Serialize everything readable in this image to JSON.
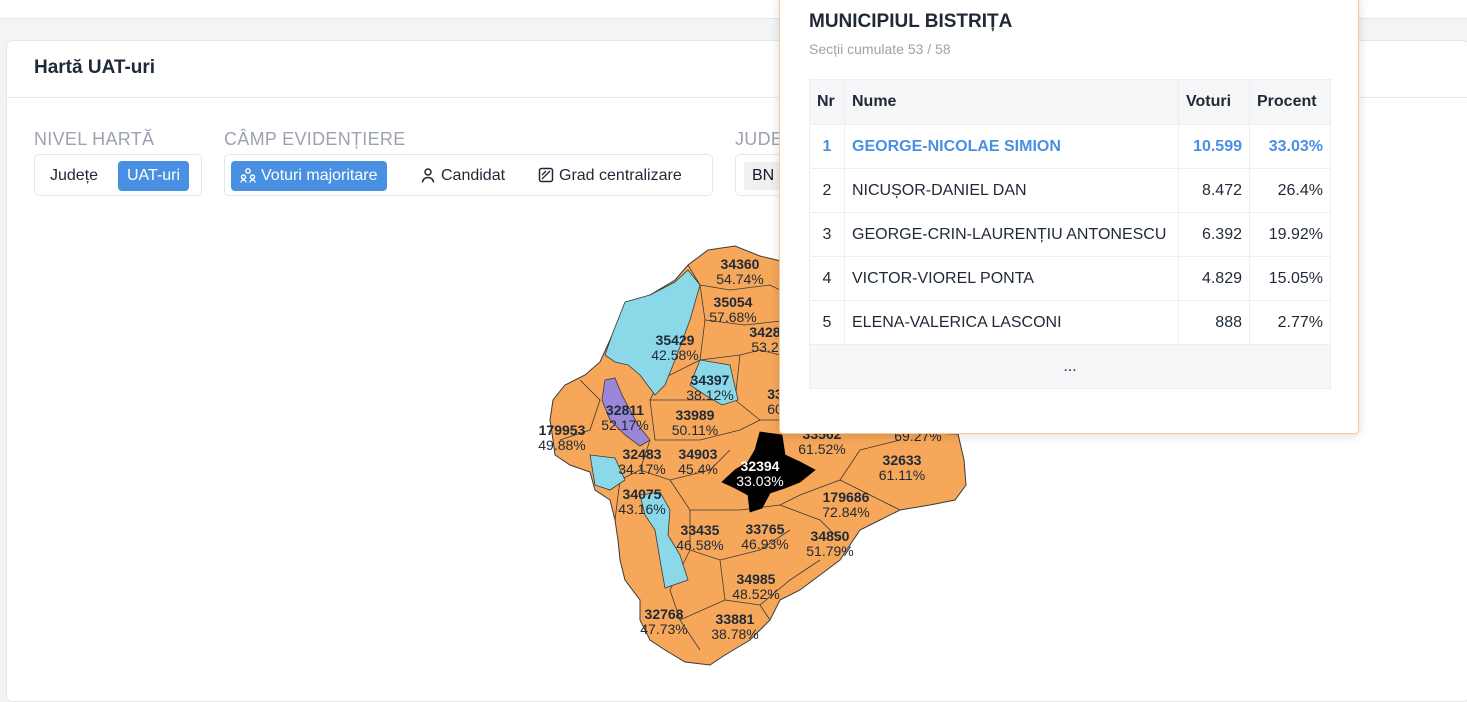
{
  "page": {
    "title": "Hartă UAT-uri"
  },
  "controls": {
    "nivel_label": "NIVEL HARTĂ",
    "nivel_options": [
      {
        "label": "Județe",
        "active": false
      },
      {
        "label": "UAT-uri",
        "active": true
      }
    ],
    "camp_label": "CÂMP EVIDENȚIERE",
    "camp_options": [
      {
        "label": "Voturi majoritare",
        "icon": "people-group-icon",
        "active": true
      },
      {
        "label": "Candidat",
        "icon": "person-icon",
        "active": false
      },
      {
        "label": "Grad centralizare",
        "icon": "gauge-square-icon",
        "active": false
      }
    ],
    "judet_label": "JUDE",
    "judet_value": "BN"
  },
  "colors": {
    "accent": "#4a90e2",
    "orange": "#f6a75a",
    "cyan": "#8ad8e8",
    "purple": "#9b86d8",
    "selected": "#000000"
  },
  "map": {
    "labels": [
      {
        "code": "34360",
        "pct": "54.74%"
      },
      {
        "code": "35054",
        "pct": "57.68%"
      },
      {
        "code": "3428",
        "pct": "53.2"
      },
      {
        "code": "35429",
        "pct": "42.58%"
      },
      {
        "code": "34397",
        "pct": "38.12%"
      },
      {
        "code": "33",
        "pct": "60"
      },
      {
        "code": "32811",
        "pct": "52.17%"
      },
      {
        "code": "33989",
        "pct": "50.11%"
      },
      {
        "code": "179953",
        "pct": "49.88%"
      },
      {
        "code": "33562",
        "pct": "61.52%"
      },
      {
        "code": "",
        "pct": "69.27%"
      },
      {
        "code": "32483",
        "pct": "34.17%"
      },
      {
        "code": "34903",
        "pct": "45.4%"
      },
      {
        "code": "32394",
        "pct": "33.03%"
      },
      {
        "code": "32633",
        "pct": "61.11%"
      },
      {
        "code": "34075",
        "pct": "43.16%"
      },
      {
        "code": "179686",
        "pct": "72.84%"
      },
      {
        "code": "33435",
        "pct": "46.58%"
      },
      {
        "code": "33765",
        "pct": "46.93%"
      },
      {
        "code": "34850",
        "pct": "51.79%"
      },
      {
        "code": "34985",
        "pct": "48.52%"
      },
      {
        "code": "32768",
        "pct": "47.73%"
      },
      {
        "code": "33881",
        "pct": "38.78%"
      }
    ]
  },
  "popup": {
    "title": "MUNICIPIUL BISTRIȚA",
    "subtitle": "Secții cumulate 53 / 58",
    "headers": [
      "Nr",
      "Nume",
      "Voturi",
      "Procent"
    ],
    "rows": [
      {
        "nr": "1",
        "name": "GEORGE-NICOLAE SIMION",
        "votes": "10.599",
        "pct": "33.03%"
      },
      {
        "nr": "2",
        "name": "NICUȘOR-DANIEL DAN",
        "votes": "8.472",
        "pct": "26.4%"
      },
      {
        "nr": "3",
        "name": "GEORGE-CRIN-LAURENȚIU ANTONESCU",
        "votes": "6.392",
        "pct": "19.92%"
      },
      {
        "nr": "4",
        "name": "VICTOR-VIOREL PONTA",
        "votes": "4.829",
        "pct": "15.05%"
      },
      {
        "nr": "5",
        "name": "ELENA-VALERICA LASCONI",
        "votes": "888",
        "pct": "2.77%"
      }
    ],
    "more": "..."
  }
}
